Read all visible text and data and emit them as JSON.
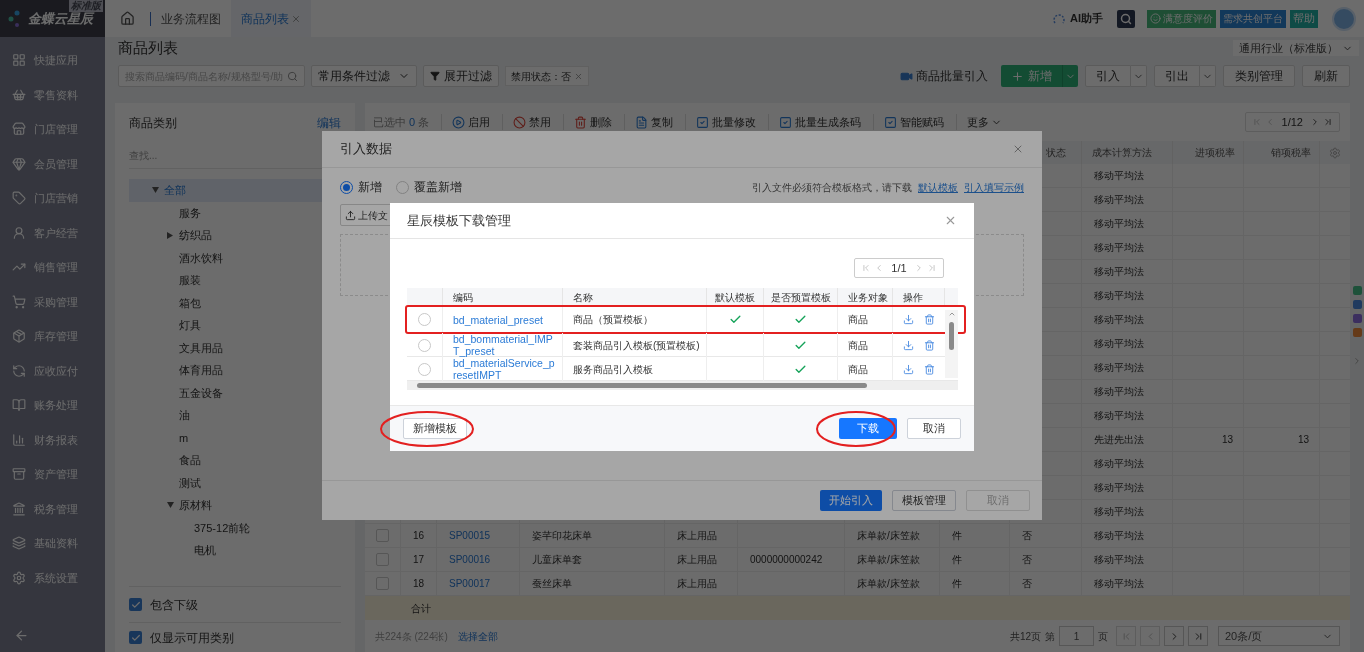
{
  "app": {
    "logo": "金蝶云星辰",
    "edition": "标准版"
  },
  "tabs": [
    {
      "label": "业务流程图",
      "selected": false,
      "closable": false
    },
    {
      "label": "商品列表",
      "selected": true,
      "closable": true
    }
  ],
  "header_actions": {
    "ai": "AI助手",
    "satisfaction": "满意度评价",
    "platform": "需求共创平台",
    "help": "帮助"
  },
  "sidebar": {
    "items": [
      "快捷应用",
      "零售资料",
      "门店管理",
      "会员管理",
      "门店营销",
      "客户经营",
      "销售管理",
      "采购管理",
      "库存管理",
      "应收应付",
      "账务处理",
      "财务报表",
      "资产管理",
      "税务管理",
      "基础资料",
      "系统设置"
    ]
  },
  "page": {
    "title": "商品列表",
    "industry": "通用行业（标准版）"
  },
  "filters": {
    "search_placeholder": "搜索商品编码/商品名称/规格型号/助",
    "preset": "常用条件过滤",
    "expand": "展开过滤",
    "tags": [
      {
        "label": "禁用状态：否"
      }
    ]
  },
  "actions": {
    "batch_import": "商品批量引入",
    "buttons": [
      {
        "label": "新增",
        "kind": "primary-split"
      },
      {
        "label": "引入",
        "kind": "split"
      },
      {
        "label": "引出",
        "kind": "split"
      },
      {
        "label": "类别管理",
        "kind": "plain"
      },
      {
        "label": "刷新",
        "kind": "plain"
      }
    ]
  },
  "category_panel": {
    "title": "商品类别",
    "edit": "编辑",
    "search_placeholder": "查找...",
    "tree": [
      {
        "label": "全部",
        "selected": true,
        "expanded": true,
        "children": [
          {
            "label": "服务",
            "selected": false
          },
          {
            "label": "纺织品",
            "selected": false,
            "expanded": false
          },
          {
            "label": "酒水饮料",
            "selected": false
          },
          {
            "label": "服装",
            "selected": false
          },
          {
            "label": "箱包",
            "selected": false
          },
          {
            "label": "灯具",
            "selected": false
          },
          {
            "label": "文具用品",
            "selected": false
          },
          {
            "label": "体育用品",
            "selected": false
          },
          {
            "label": "五金设备",
            "selected": false
          },
          {
            "label": "油",
            "selected": false
          },
          {
            "label": "m",
            "selected": false
          },
          {
            "label": "食品",
            "selected": false
          },
          {
            "label": "测试",
            "selected": false
          },
          {
            "label": "原材料",
            "selected": false,
            "expanded": true,
            "children": [
              {
                "label": "375-12前轮",
                "selected": false
              },
              {
                "label": "电机",
                "selected": false
              }
            ]
          }
        ]
      }
    ],
    "options": [
      {
        "label": "包含下级",
        "checked": true
      },
      {
        "label": "仅显示可用类别",
        "checked": true
      }
    ]
  },
  "list_toolbar": {
    "selection": "已选中",
    "selected_count": "0",
    "selection_unit": "条",
    "actions": [
      {
        "label": "启用",
        "kind": "enable"
      },
      {
        "label": "禁用",
        "kind": "disable"
      },
      {
        "label": "删除",
        "kind": "delete"
      },
      {
        "label": "复制",
        "kind": "copy"
      },
      {
        "label": "批量修改",
        "kind": "batch"
      },
      {
        "label": "批量生成条码",
        "kind": "batch"
      },
      {
        "label": "智能赋码",
        "kind": "batch"
      }
    ],
    "more": "更多",
    "pager": "1/12"
  },
  "table": {
    "headers": {
      "status": "状态",
      "cost_method": "成本计算方法",
      "input_tax": "进项税率",
      "output_tax": "销项税率"
    },
    "rows": [
      {
        "cost_method": "移动平均法"
      },
      {
        "cost_method": "移动平均法"
      },
      {
        "cost_method": "移动平均法"
      },
      {
        "cost_method": "移动平均法"
      },
      {
        "cost_method": "移动平均法"
      },
      {
        "cost_method": "移动平均法"
      },
      {
        "cost_method": "移动平均法"
      },
      {
        "cost_method": "移动平均法"
      },
      {
        "cost_method": "移动平均法"
      },
      {
        "cost_method": "移动平均法"
      },
      {
        "cost_method": "移动平均法"
      },
      {
        "cost_method": "先进先出法",
        "input_tax": "13",
        "output_tax": "13"
      },
      {
        "cost_method": "移动平均法"
      },
      {
        "cost_method": "移动平均法"
      },
      {
        "cost_method": "移动平均法"
      },
      {
        "checked": false,
        "seq": "16",
        "code": "SP00015",
        "name": "姿芊印花床单",
        "category": "床上用品",
        "spec": "床单款/床笠款",
        "unit": "件",
        "status": "否",
        "cost_method": "移动平均法"
      },
      {
        "checked": false,
        "seq": "17",
        "code": "SP00016",
        "name": "儿童床单套",
        "category": "床上用品",
        "barcode": "0000000000242",
        "spec": "床单款/床笠款",
        "unit": "件",
        "status": "否",
        "cost_method": "移动平均法"
      },
      {
        "checked": false,
        "seq": "18",
        "code": "SP00017",
        "name": "蚕丝床单",
        "category": "床上用品",
        "spec": "床单款/床笠款",
        "unit": "件",
        "status": "否",
        "cost_method": "移动平均法"
      }
    ],
    "total_label": "合计"
  },
  "footer": {
    "count": "共224条 (224张)",
    "select_all": "选择全部",
    "pages": "共12页",
    "page_prefix": "第",
    "page": "1",
    "page_suffix": "页",
    "page_size": "20条/页"
  },
  "import_dialog": {
    "title": "引入数据",
    "modes": [
      {
        "label": "新增",
        "selected": true
      },
      {
        "label": "覆盖新增",
        "selected": false
      }
    ],
    "hint": "引入文件必须符合模板格式，请下载",
    "links": [
      "默认模板",
      "引入填写示例"
    ],
    "upload": "上传文",
    "buttons": [
      {
        "label": "开始引入",
        "kind": "primary"
      },
      {
        "label": "模板管理",
        "kind": "default"
      },
      {
        "label": "取消",
        "kind": "disabled"
      }
    ]
  },
  "template_dialog": {
    "title": "星辰模板下载管理",
    "pager": "1/1",
    "columns": [
      "编码",
      "名称",
      "默认模板",
      "是否预置模板",
      "业务对象",
      "操作"
    ],
    "rows": [
      {
        "code": "bd_material_preset",
        "name": "商品（预置模板）",
        "default": true,
        "preset": true,
        "object": "商品",
        "selected": false,
        "highlighted": true
      },
      {
        "code": "bd_bommaterial_IMPT_preset",
        "name": "套装商品引入模板(预置模板)",
        "default": false,
        "preset": true,
        "object": "商品",
        "selected": false,
        "highlighted": false
      },
      {
        "code": "bd_materialService_presetIMPT",
        "name": "服务商品引入模板",
        "default": false,
        "preset": true,
        "object": "商品",
        "selected": false,
        "highlighted": false
      }
    ],
    "buttons": [
      {
        "label": "新增模板",
        "kind": "default",
        "circled": true
      },
      {
        "label": "下载",
        "kind": "primary",
        "circled": true
      },
      {
        "label": "取消",
        "kind": "default",
        "circled": false
      }
    ]
  }
}
